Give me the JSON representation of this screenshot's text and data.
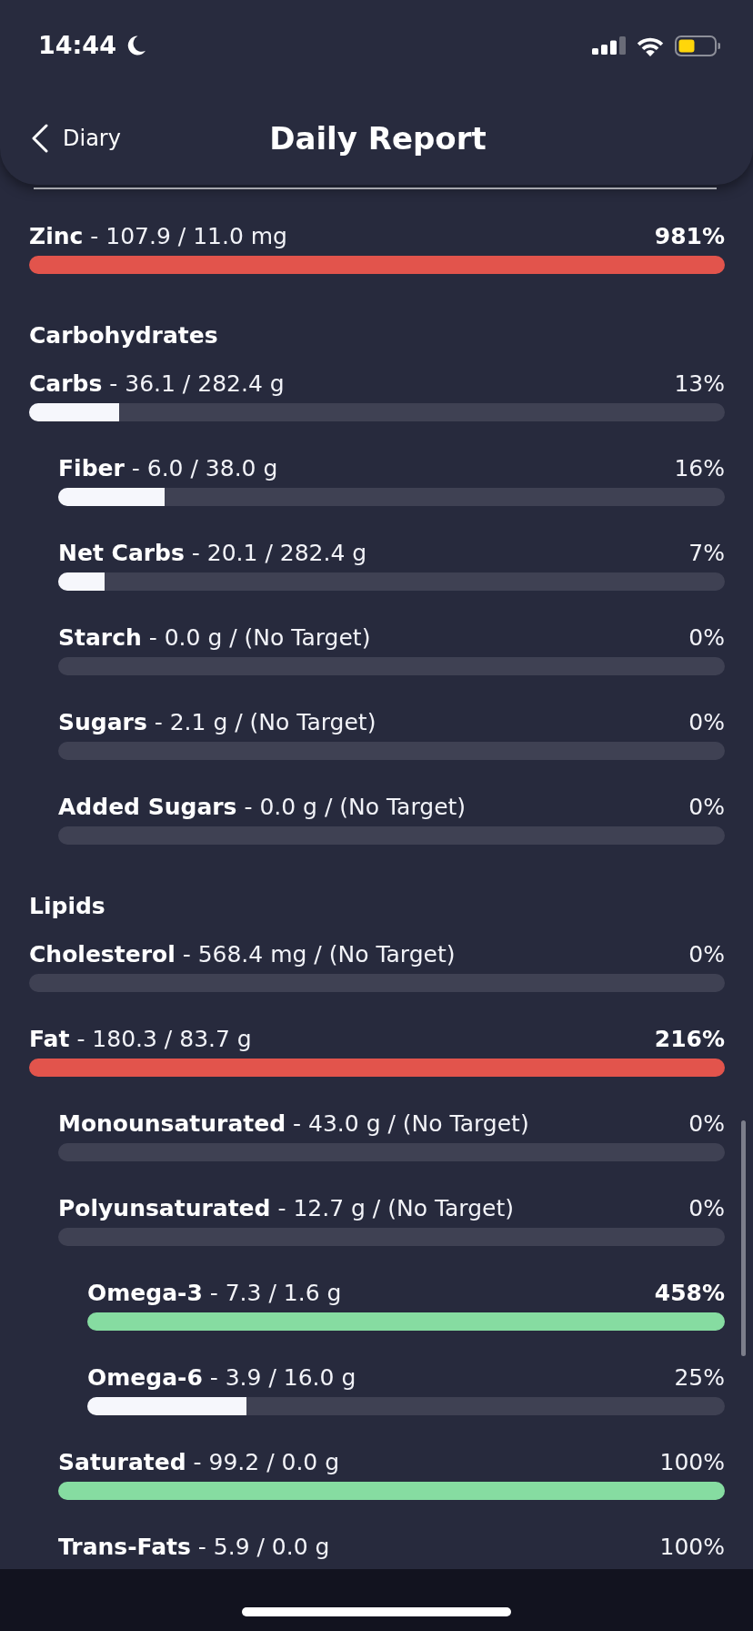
{
  "status_bar": {
    "time": "14:44"
  },
  "nav": {
    "back_label": "Diary",
    "title": "Daily Report"
  },
  "sections": [
    {
      "items": [
        {
          "label": "**Zinc** - 107.9 / 11.0 mg",
          "percent": "981%",
          "emphasized": true,
          "level": 1,
          "color": "#e2544c"
        }
      ]
    },
    {
      "heading": "Carbohydrates",
      "items": [
        {
          "label": "**Carbs** - 36.1 / 282.4 g",
          "percent": "13%",
          "emphasized": false,
          "level": 0.13,
          "color": "#f6f7fc",
          "children": [
            {
              "label": "**Fiber** - 6.0 / 38.0 g",
              "percent": "16%",
              "emphasized": false,
              "level": 0.16,
              "color": "#f6f7fc"
            },
            {
              "label": "**Net Carbs** - 20.1 / 282.4 g",
              "percent": "7%",
              "emphasized": false,
              "level": 0.07,
              "color": "#f6f7fc"
            },
            {
              "label": "**Starch** - 0.0 g / (No Target)",
              "percent": "0%",
              "emphasized": false,
              "level": 0
            },
            {
              "label": "**Sugars** - 2.1 g / (No Target)",
              "percent": "0%",
              "emphasized": false,
              "level": 0
            },
            {
              "label": "**Added Sugars** - 0.0 g / (No Target)",
              "percent": "0%",
              "emphasized": false,
              "level": 0
            }
          ]
        }
      ]
    },
    {
      "heading": "Lipids",
      "items": [
        {
          "label": "**Cholesterol** - 568.4 mg / (No Target)",
          "percent": "0%",
          "emphasized": false,
          "level": 0
        },
        {
          "label": "**Fat** - 180.3 / 83.7 g",
          "percent": "216%",
          "emphasized": true,
          "level": 1,
          "color": "#e2544c",
          "children": [
            {
              "label": "**Monounsaturated** - 43.0 g / (No Target)",
              "percent": "0%",
              "emphasized": false,
              "level": 0
            },
            {
              "label": "**Polyunsaturated** - 12.7 g / (No Target)",
              "percent": "0%",
              "emphasized": false,
              "level": 0,
              "children": [
                {
                  "label": "**Omega-3** - 7.3 / 1.6 g",
                  "percent": "458%",
                  "emphasized": true,
                  "level": 1,
                  "color": "#86dca1"
                },
                {
                  "label": "**Omega-6** - 3.9 / 16.0 g",
                  "percent": "25%",
                  "emphasized": false,
                  "level": 0.25,
                  "color": "#f6f7fc"
                }
              ]
            },
            {
              "label": "**Saturated** - 99.2 / 0.0 g",
              "percent": "100%",
              "emphasized": false,
              "level": 1,
              "color": "#86dca1"
            },
            {
              "label": "**Trans-Fats** - 5.9 / 0.0 g",
              "percent": "100%",
              "emphasized": false
            }
          ]
        }
      ]
    }
  ]
}
